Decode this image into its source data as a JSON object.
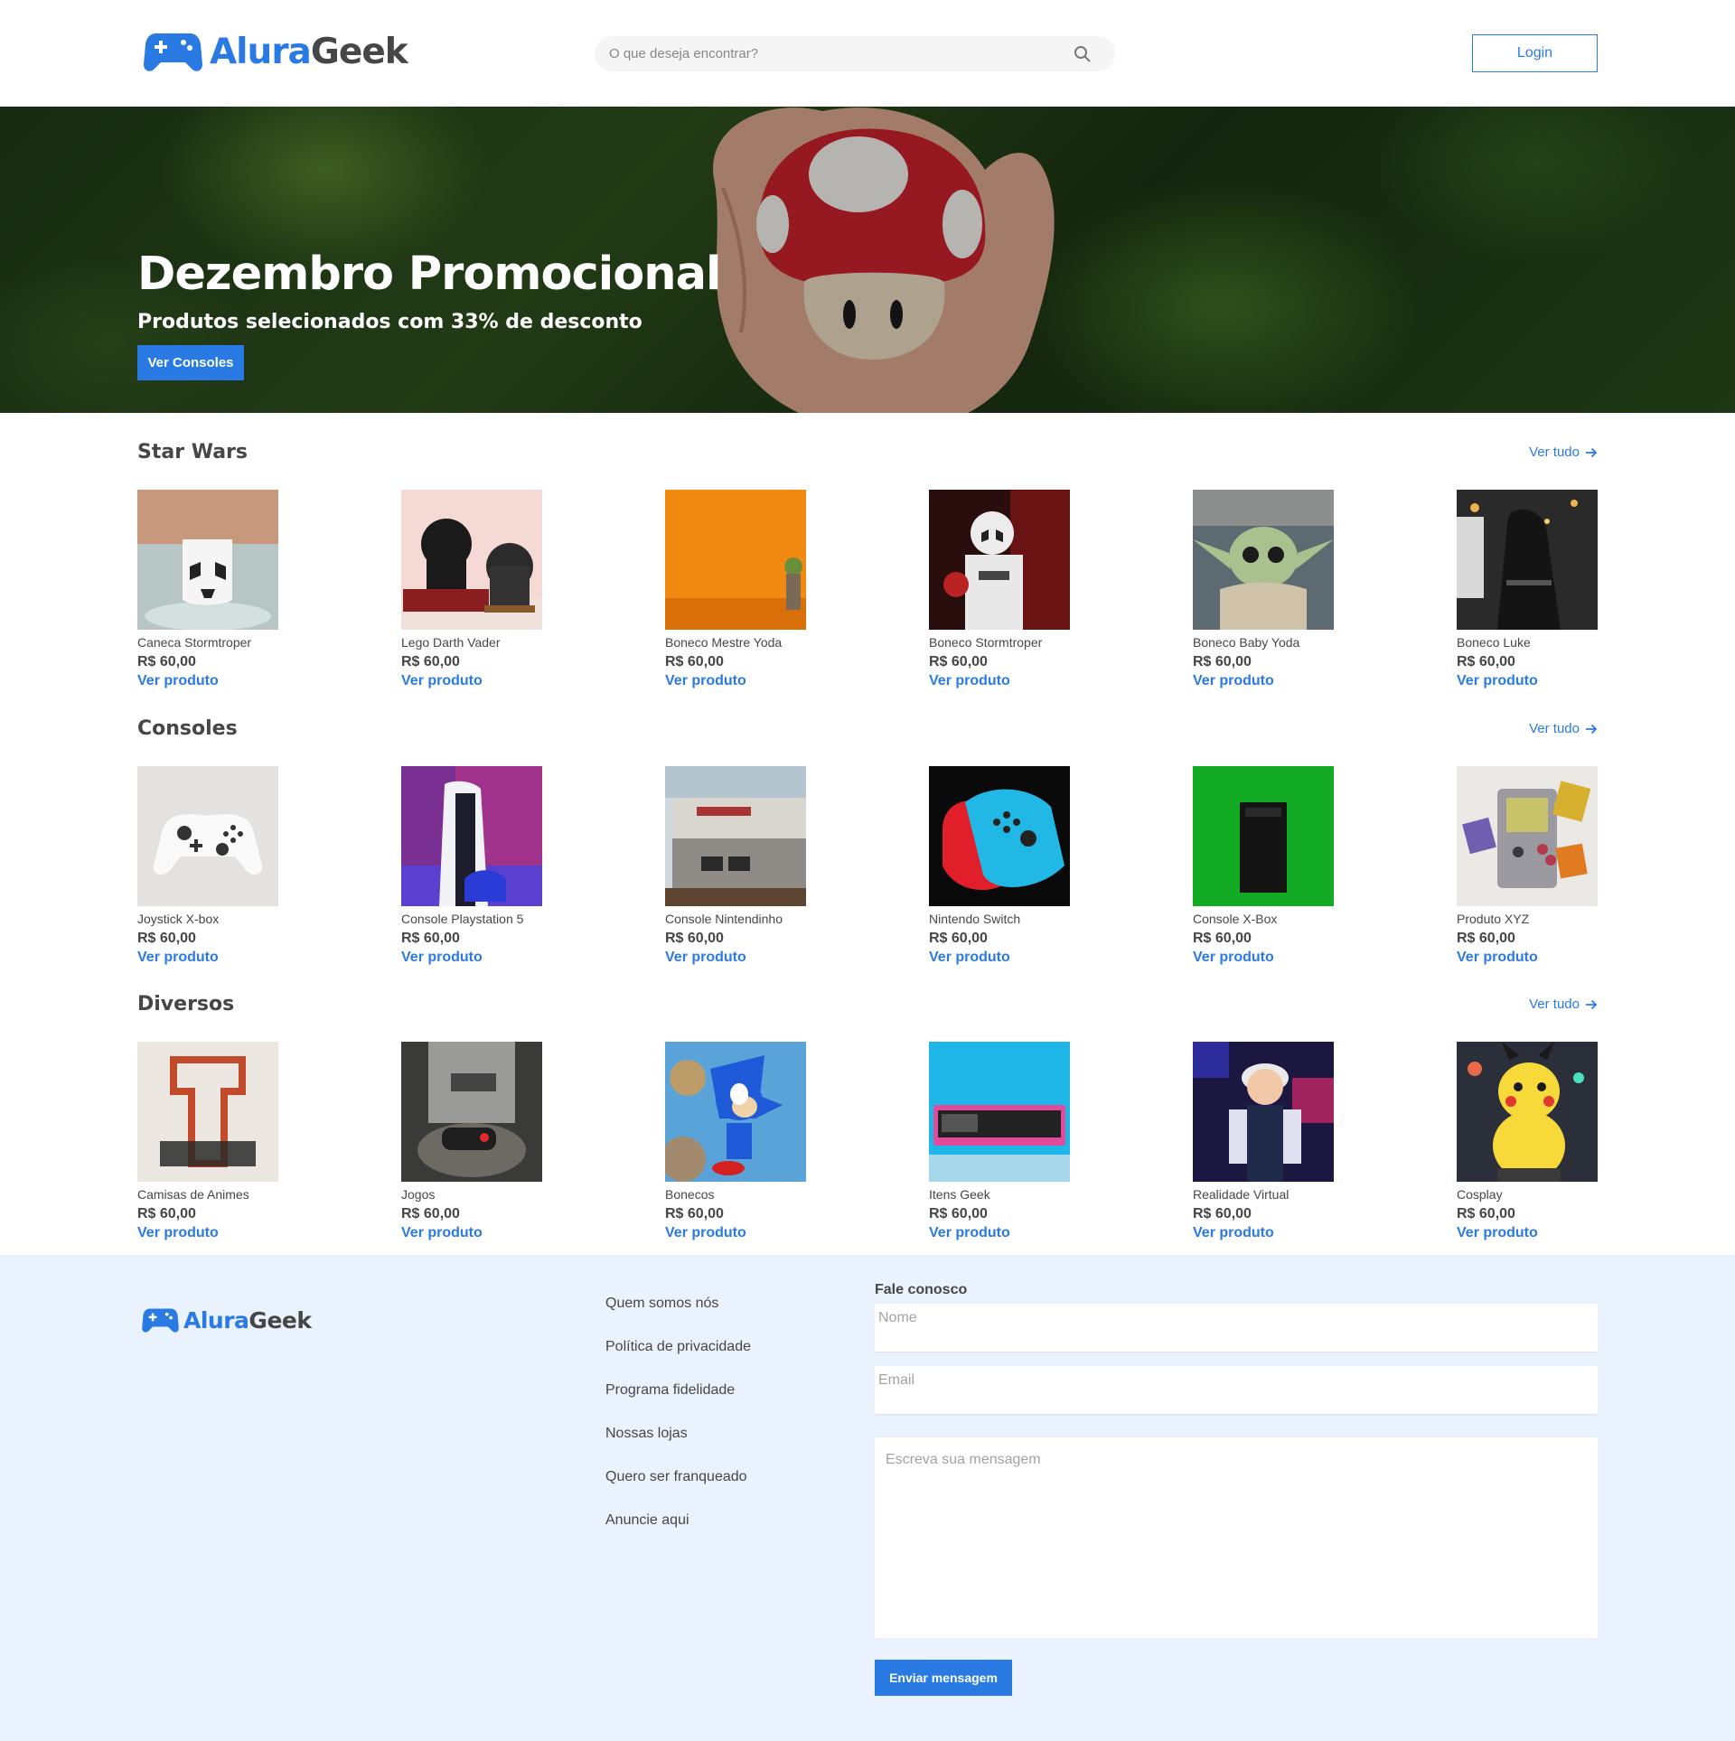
{
  "brand": {
    "name_part1": "Alura",
    "name_part2": "Geek",
    "accent": "#2A7AE4",
    "text": "#464646"
  },
  "header": {
    "search_placeholder": "O que deseja encontrar?",
    "login_label": "Login"
  },
  "hero": {
    "title": "Dezembro Promocional",
    "subtitle": "Produtos selecionados com 33% de desconto",
    "button_label": "Ver Consoles"
  },
  "sections": [
    {
      "title": "Star Wars",
      "see_all": "Ver tudo",
      "products": [
        {
          "name": "Caneca Stormtroper",
          "price": "R$ 60,00",
          "link": "Ver produto",
          "thumb": "mug"
        },
        {
          "name": "Lego Darth Vader",
          "price": "R$ 60,00",
          "link": "Ver produto",
          "thumb": "lego"
        },
        {
          "name": "Boneco Mestre Yoda",
          "price": "R$ 60,00",
          "link": "Ver produto",
          "thumb": "yoda"
        },
        {
          "name": "Boneco Stormtroper",
          "price": "R$ 60,00",
          "link": "Ver produto",
          "thumb": "trooper"
        },
        {
          "name": "Boneco Baby Yoda",
          "price": "R$ 60,00",
          "link": "Ver produto",
          "thumb": "babyyoda"
        },
        {
          "name": "Boneco Luke",
          "price": "R$ 60,00",
          "link": "Ver produto",
          "thumb": "luke"
        }
      ]
    },
    {
      "title": "Consoles",
      "see_all": "Ver tudo",
      "products": [
        {
          "name": "Joystick X-box",
          "price": "R$ 60,00",
          "link": "Ver produto",
          "thumb": "xboxpad"
        },
        {
          "name": "Console Playstation 5",
          "price": "R$ 60,00",
          "link": "Ver produto",
          "thumb": "ps5"
        },
        {
          "name": "Console Nintendinho",
          "price": "R$ 60,00",
          "link": "Ver produto",
          "thumb": "nes"
        },
        {
          "name": "Nintendo Switch",
          "price": "R$ 60,00",
          "link": "Ver produto",
          "thumb": "switch"
        },
        {
          "name": "Console X-Box",
          "price": "R$ 60,00",
          "link": "Ver produto",
          "thumb": "xboxx"
        },
        {
          "name": "Produto XYZ",
          "price": "R$ 60,00",
          "link": "Ver produto",
          "thumb": "gameboy"
        }
      ]
    },
    {
      "title": "Diversos",
      "see_all": "Ver tudo",
      "products": [
        {
          "name": "Camisas de Animes",
          "price": "R$ 60,00",
          "link": "Ver produto",
          "thumb": "shirt"
        },
        {
          "name": "Jogos",
          "price": "R$ 60,00",
          "link": "Ver produto",
          "thumb": "games"
        },
        {
          "name": "Bonecos",
          "price": "R$ 60,00",
          "link": "Ver produto",
          "thumb": "sonic"
        },
        {
          "name": "Itens Geek",
          "price": "R$ 60,00",
          "link": "Ver produto",
          "thumb": "clock"
        },
        {
          "name": "Realidade Virtual",
          "price": "R$ 60,00",
          "link": "Ver produto",
          "thumb": "vr"
        },
        {
          "name": "Cosplay",
          "price": "R$ 60,00",
          "link": "Ver produto",
          "thumb": "pikachu"
        }
      ]
    }
  ],
  "footer": {
    "links": [
      "Quem somos nós",
      "Política de privacidade",
      "Programa fidelidade",
      "Nossas lojas",
      "Quero ser franqueado",
      "Anuncie aqui"
    ],
    "contact": {
      "title": "Fale conosco",
      "name_placeholder": "Nome",
      "email_placeholder": "Email",
      "message_placeholder": "Escreva sua mensagem",
      "submit_label": "Enviar mensagem"
    }
  }
}
